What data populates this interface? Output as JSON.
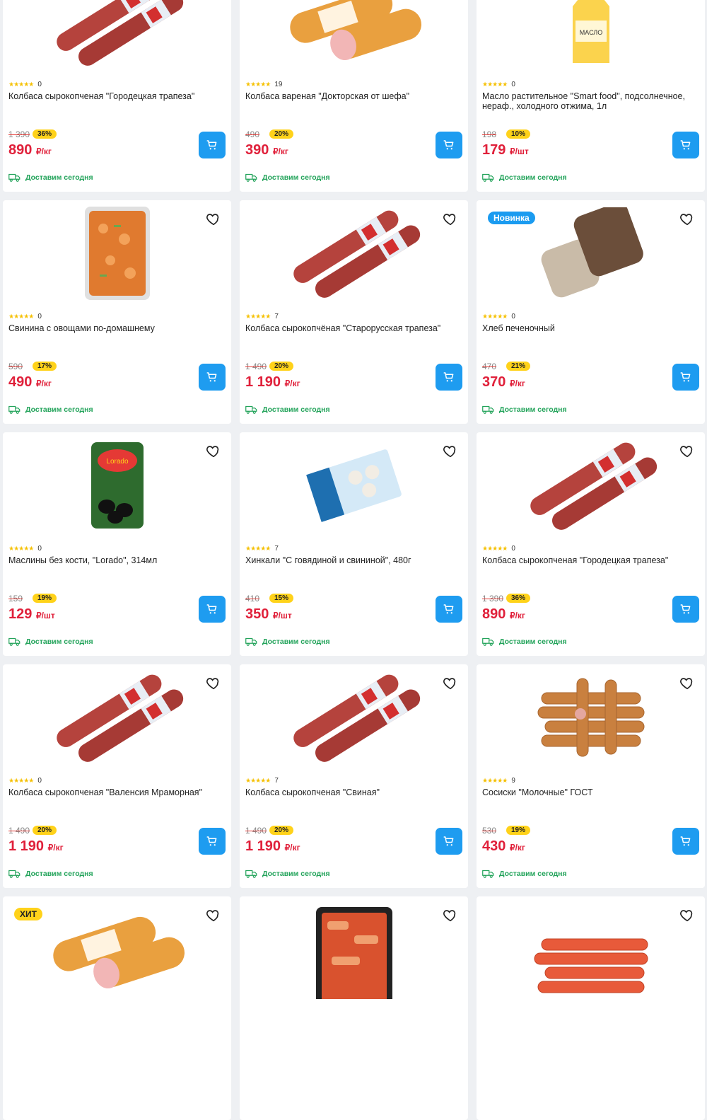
{
  "products": [
    {
      "title": "Колбаса сырокопченая \"Городецкая трапеза\"",
      "rating_count": "0",
      "old_price": "1 390",
      "discount": "36%",
      "price": "890",
      "unit": "₽/кг",
      "delivery": "Доставим сегодня",
      "image": "salami-sticks",
      "badge": ""
    },
    {
      "title": "Колбаса вареная \"Докторская от шефа\"",
      "rating_count": "19",
      "old_price": "490",
      "discount": "20%",
      "price": "390",
      "unit": "₽/кг",
      "delivery": "Доставим сегодня",
      "image": "boiled-sausage",
      "badge": ""
    },
    {
      "title": "Масло растительное \"Smart food\", подсолнечное, нераф., холодного отжима, 1л",
      "rating_count": "0",
      "old_price": "198",
      "discount": "10%",
      "price": "179",
      "unit": "₽/шт",
      "delivery": "Доставим сегодня",
      "image": "oil-bottle",
      "badge": ""
    },
    {
      "title": "Свинина с овощами по-домашнему",
      "rating_count": "0",
      "old_price": "590",
      "discount": "17%",
      "price": "490",
      "unit": "₽/кг",
      "delivery": "Доставим сегодня",
      "image": "tray-dish",
      "badge": ""
    },
    {
      "title": "Колбаса сырокопчёная \"Старорусская трапеза\"",
      "rating_count": "7",
      "old_price": "1 490",
      "discount": "20%",
      "price": "1 190",
      "unit": "₽/кг",
      "delivery": "Доставим сегодня",
      "image": "salami-sticks",
      "badge": ""
    },
    {
      "title": "Хлеб печеночный",
      "rating_count": "0",
      "old_price": "470",
      "discount": "21%",
      "price": "370",
      "unit": "₽/кг",
      "delivery": "Доставим сегодня",
      "image": "meat-loaf",
      "badge": "Новинка"
    },
    {
      "title": "Маслины без кости, \"Lorado\", 314мл",
      "rating_count": "0",
      "old_price": "159",
      "discount": "19%",
      "price": "129",
      "unit": "₽/шт",
      "delivery": "Доставим сегодня",
      "image": "olive-can",
      "badge": ""
    },
    {
      "title": "Хинкали \"С говядиной и свининой\", 480г",
      "rating_count": "7",
      "old_price": "410",
      "discount": "15%",
      "price": "350",
      "unit": "₽/шт",
      "delivery": "Доставим сегодня",
      "image": "khinkali-box",
      "badge": ""
    },
    {
      "title": "Колбаса сырокопченая \"Городецкая трапеза\"",
      "rating_count": "0",
      "old_price": "1 390",
      "discount": "36%",
      "price": "890",
      "unit": "₽/кг",
      "delivery": "Доставим сегодня",
      "image": "salami-sticks",
      "badge": ""
    },
    {
      "title": "Колбаса сырокопченая \"Валенсия Мраморная\"",
      "rating_count": "0",
      "old_price": "1 490",
      "discount": "20%",
      "price": "1 190",
      "unit": "₽/кг",
      "delivery": "Доставим сегодня",
      "image": "salami-sticks",
      "badge": ""
    },
    {
      "title": "Колбаса сырокопченая \"Свиная\"",
      "rating_count": "7",
      "old_price": "1 490",
      "discount": "20%",
      "price": "1 190",
      "unit": "₽/кг",
      "delivery": "Доставим сегодня",
      "image": "salami-sticks",
      "badge": ""
    },
    {
      "title": "Сосиски \"Молочные\" ГОСТ",
      "rating_count": "9",
      "old_price": "530",
      "discount": "19%",
      "price": "430",
      "unit": "₽/кг",
      "delivery": "Доставим сегодня",
      "image": "wieners",
      "badge": ""
    },
    {
      "title": "",
      "rating_count": "",
      "old_price": "",
      "discount": "",
      "price": "",
      "unit": "",
      "delivery": "",
      "image": "boiled-sausage",
      "badge": "ХИТ"
    },
    {
      "title": "",
      "rating_count": "",
      "old_price": "",
      "discount": "",
      "price": "",
      "unit": "",
      "delivery": "",
      "image": "tray-meat",
      "badge": ""
    },
    {
      "title": "",
      "rating_count": "",
      "old_price": "",
      "discount": "",
      "price": "",
      "unit": "",
      "delivery": "",
      "image": "wieners-red",
      "badge": ""
    }
  ],
  "stars": "★★★★★",
  "colors": {
    "accent": "#1e9cf0",
    "price": "#e0203a",
    "discount_bg": "#ffd21a",
    "delivery": "#22a35a"
  }
}
